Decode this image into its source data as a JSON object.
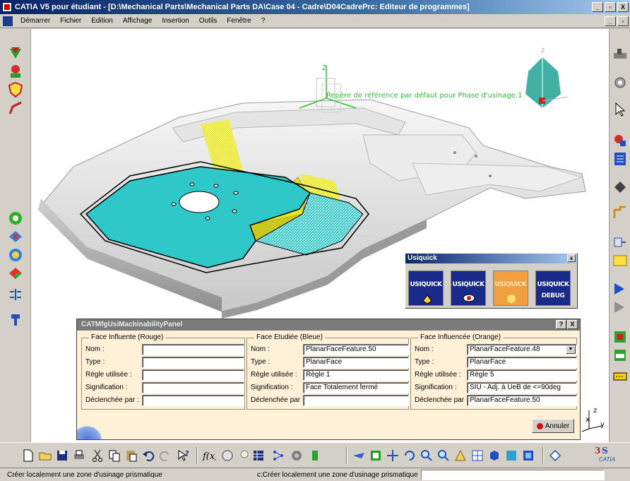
{
  "window": {
    "title": "CATIA V5 pour étudiant - [D:\\Mechanical Parts\\Mechanical Parts DA\\Case 04 - Cadre\\D04CadrePrc: Editeur de programmes]",
    "min": "_",
    "restore": "▫",
    "close": "X"
  },
  "menu": {
    "items": [
      "Démarrer",
      "Fichier",
      "Edition",
      "Affichage",
      "Insertion",
      "Outils",
      "Fenêtre",
      "?"
    ]
  },
  "viewport": {
    "annotation": "Repère de référence par défaut pour Phase d'usinage.1",
    "axis_z": "z",
    "axis_x": "x",
    "axis_y": "y"
  },
  "usiquick": {
    "title": "Usiquick",
    "close": "x",
    "buttons": [
      {
        "label": "USIQUICK",
        "color": "#1a2a8a"
      },
      {
        "label": "USIQUICK",
        "color": "#1a2a8a"
      },
      {
        "label": "USIQUICK",
        "color": "#f0a040"
      },
      {
        "label": "USIQUICK",
        "sub": "DEBUG",
        "color": "#1a2a8a"
      }
    ]
  },
  "panel": {
    "title": "CATMfgUsiMachinabilityPanel",
    "help": "?",
    "close": "X",
    "groups": [
      {
        "legend": "Face Influente (Rouge)",
        "labels": [
          "Nom :",
          "Type :",
          "Règle utilisée :",
          "Signification :",
          "Déclenchée par :"
        ],
        "values": [
          "",
          "",
          "",
          "",
          ""
        ]
      },
      {
        "legend": "Face Etudiée (Bleue)",
        "labels": [
          "Nom :",
          "Type :",
          "Règle utilisée :",
          "Signification :",
          "Déclenchée par :"
        ],
        "values": [
          "PlanarFaceFeature.50",
          "PlanarFace",
          "Règle 1",
          "Face Totalement fermé",
          ""
        ]
      },
      {
        "legend": "Face Influencée (Orange)",
        "labels": [
          "Nom :",
          "Type :",
          "Règle utilisée :",
          "Signification :",
          "Déclenchée par :"
        ],
        "values": [
          "PlanarFaceFeature.48",
          "PlanarFace",
          "Règle 5",
          "SIU - Adj. à UeB de <=90deg",
          "PlanarFaceFeature.50"
        ]
      }
    ],
    "cancel": "Annuler"
  },
  "status": {
    "left": "Créer localement une zone d'usinage prismatique",
    "middle": "c:Créer localement une zone d'usinage prismatique",
    "input": ""
  },
  "brand": {
    "logo_text": "CATIA"
  },
  "colors": {
    "study_face": "#2ec8c8",
    "influence_face": "#e6e628",
    "compass": "#2ea89a"
  }
}
